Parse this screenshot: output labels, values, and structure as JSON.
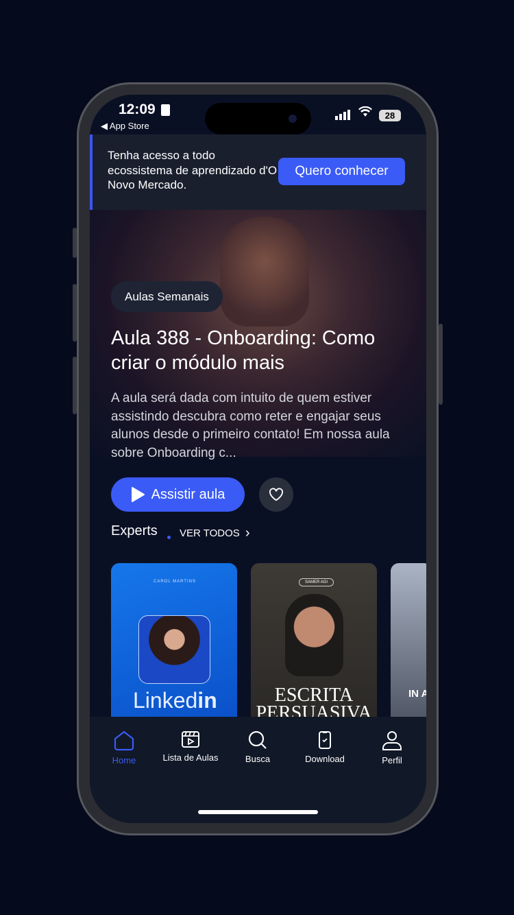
{
  "status": {
    "time": "12:09",
    "back_app": "App Store",
    "battery": "28"
  },
  "banner": {
    "text": "Tenha acesso a todo ecossistema de aprendizado d'O Novo Mercado.",
    "cta": "Quero conhecer"
  },
  "hero": {
    "chip": "Aulas Semanais",
    "title": "Aula 388 - Onboarding: Como criar o módulo mais",
    "description": "A aula será dada com intuito de quem estiver assistindo descubra como reter e engajar seus alunos desde o primeiro contato! Em nossa aula sobre Onboarding c...",
    "play_label": "Assistir aula"
  },
  "experts": {
    "heading": "Experts",
    "see_all": "VER TODOS",
    "cards": [
      {
        "brand": "CAROL MARTINS",
        "title_light": "Linked",
        "title_bold": "in"
      },
      {
        "brand": "SAMER AGI",
        "title": "ESCRITA PERSUASIVA"
      },
      {
        "title": "IN A"
      }
    ]
  },
  "tabs": [
    {
      "label": "Home",
      "icon": "home-icon",
      "active": true
    },
    {
      "label": "Lista de Aulas",
      "icon": "video-list-icon"
    },
    {
      "label": "Busca",
      "icon": "search-icon"
    },
    {
      "label": "Download",
      "icon": "phone-download-icon"
    },
    {
      "label": "Perfil",
      "icon": "user-icon"
    }
  ],
  "colors": {
    "accent": "#3b5bf6",
    "background": "#0a1024",
    "tabbar": "#111827"
  }
}
